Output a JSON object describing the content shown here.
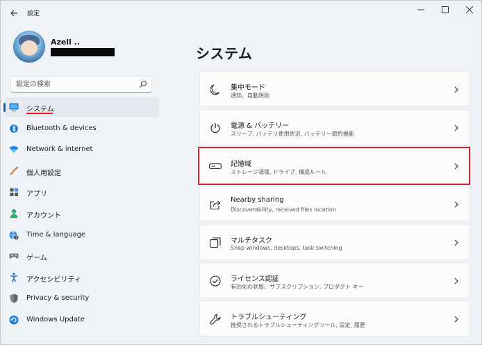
{
  "app": {
    "title": "設定"
  },
  "user": {
    "name": "Azell .."
  },
  "search": {
    "placeholder": "設定の検索"
  },
  "sidebar": {
    "items": [
      {
        "label": "システム",
        "icon": "monitor-icon",
        "selected": true
      },
      {
        "label": "Bluetooth & devices",
        "icon": "bluetooth-icon"
      },
      {
        "label": "Network & internet",
        "icon": "wifi-icon"
      },
      {
        "label": "個人用設定",
        "icon": "brush-icon"
      },
      {
        "label": "アプリ",
        "icon": "apps-icon"
      },
      {
        "label": "アカウント",
        "icon": "person-icon"
      },
      {
        "label": "Time & language",
        "icon": "globe-clock-icon"
      },
      {
        "label": "ゲーム",
        "icon": "gamepad-icon"
      },
      {
        "label": "アクセシビリティ",
        "icon": "accessibility-icon"
      },
      {
        "label": "Privacy & security",
        "icon": "shield-icon"
      },
      {
        "label": "Windows Update",
        "icon": "update-icon"
      }
    ]
  },
  "main": {
    "title": "システム",
    "cards": [
      {
        "title": "集中モード",
        "subtitle": "通知、自動規則",
        "icon": "moon-icon"
      },
      {
        "title": "電源 & バッテリー",
        "subtitle": "スリープ, バッテリ使用状況, バッテリー節約機能",
        "icon": "power-icon"
      },
      {
        "title": "記憶域",
        "subtitle": "ストレージ領域, ドライブ, 構成ルール",
        "icon": "storage-icon"
      },
      {
        "title": "Nearby sharing",
        "subtitle": "Discoverability, received files location",
        "icon": "share-icon"
      },
      {
        "title": "マルチタスク",
        "subtitle": "Snap windows, desktops, task switching",
        "icon": "multitask-icon"
      },
      {
        "title": "ライセンス認証",
        "subtitle": "有効化の状態、サブスクリプション, プロダクト キー",
        "icon": "check-circle-icon"
      },
      {
        "title": "トラブルシューティング",
        "subtitle": "推奨されるトラブルシューティングツール, 設定, 履歴",
        "icon": "wrench-icon"
      }
    ]
  },
  "colors": {
    "accent": "#0067c0",
    "highlight": "#d8222a",
    "underline": "#e21a1a"
  }
}
